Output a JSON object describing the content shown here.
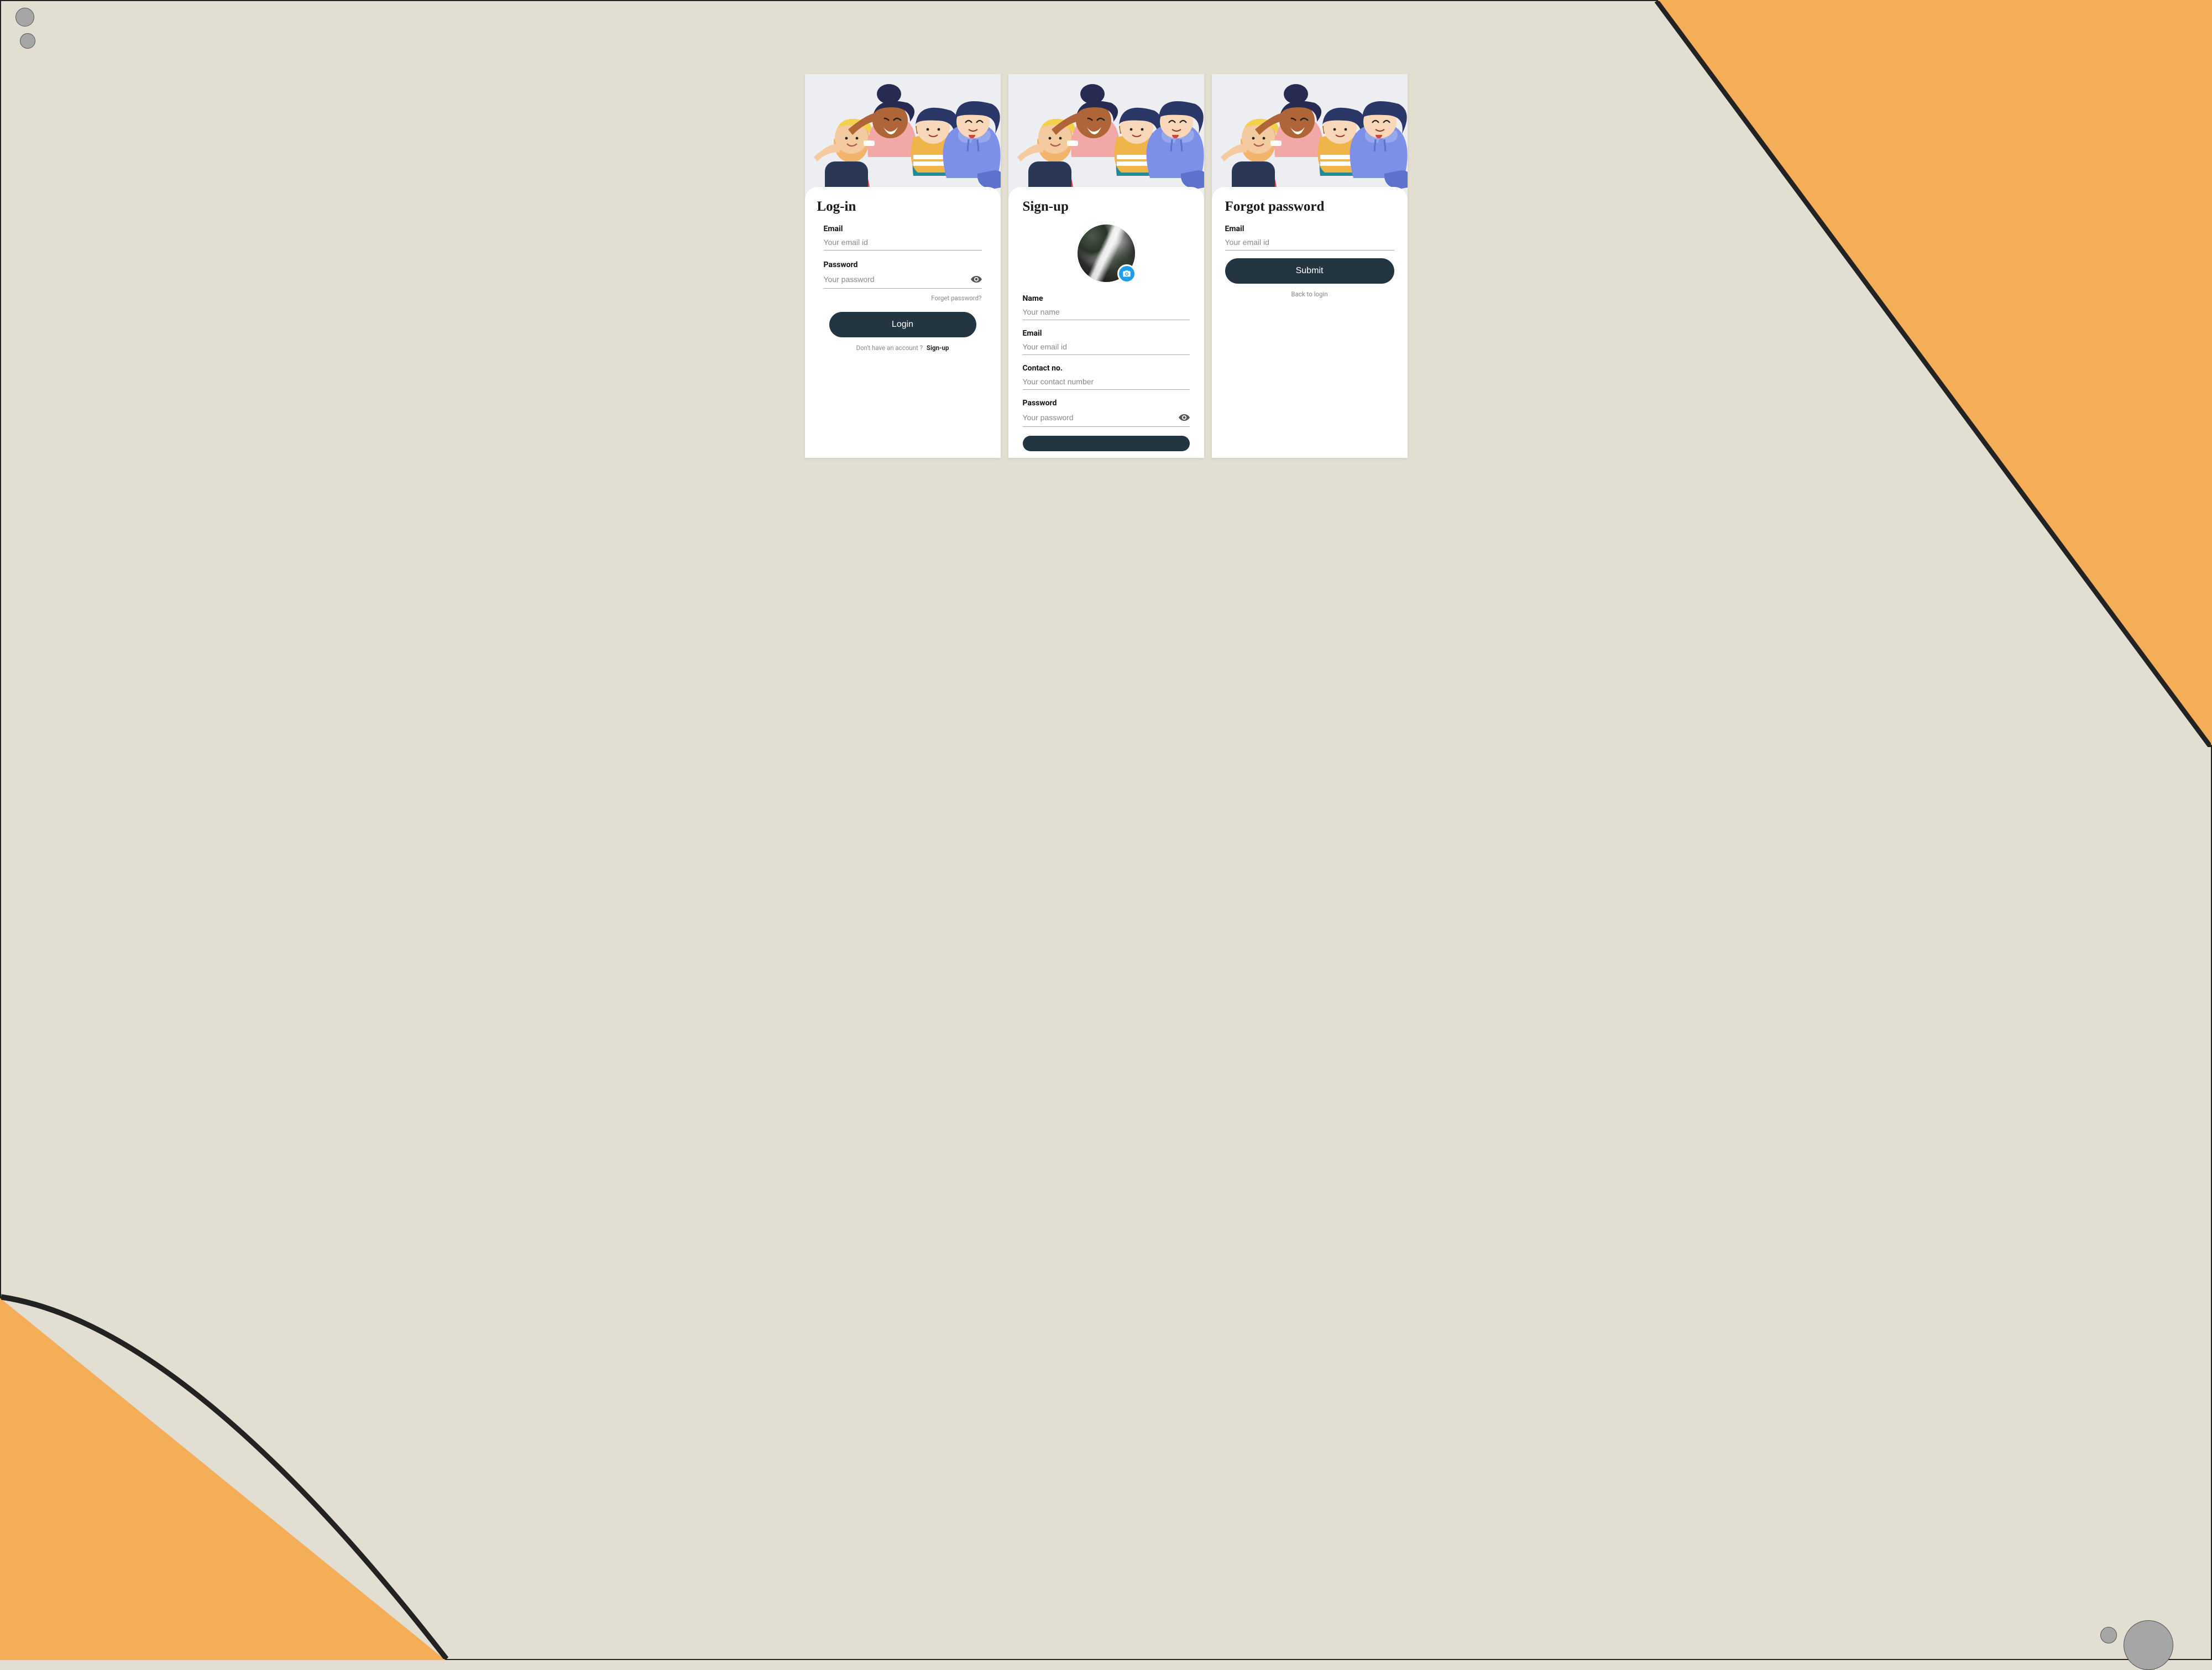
{
  "colors": {
    "accent": "#233540",
    "bg": "#e2ded2",
    "orange": "#f4ae57",
    "camera_badge": "#1e9ee6"
  },
  "login": {
    "title": "Log-in",
    "email_label": "Email",
    "email_placeholder": "Your email id",
    "password_label": "Password",
    "password_placeholder": "Your password",
    "forgot_link": "Forget password?",
    "button": "Login",
    "footer_text": "Don't have an account ?",
    "footer_action": "Sign-up"
  },
  "signup": {
    "title": "Sign-up",
    "name_label": "Name",
    "name_placeholder": "Your name",
    "email_label": "Email",
    "email_placeholder": "Your email id",
    "contact_label": "Contact no.",
    "contact_placeholder": "Your contact number",
    "password_label": "Password",
    "password_placeholder": "Your password"
  },
  "forgot": {
    "title": "Forgot password",
    "email_label": "Email",
    "email_placeholder": "Your email id",
    "button": "Submit",
    "back": "Back to login"
  }
}
